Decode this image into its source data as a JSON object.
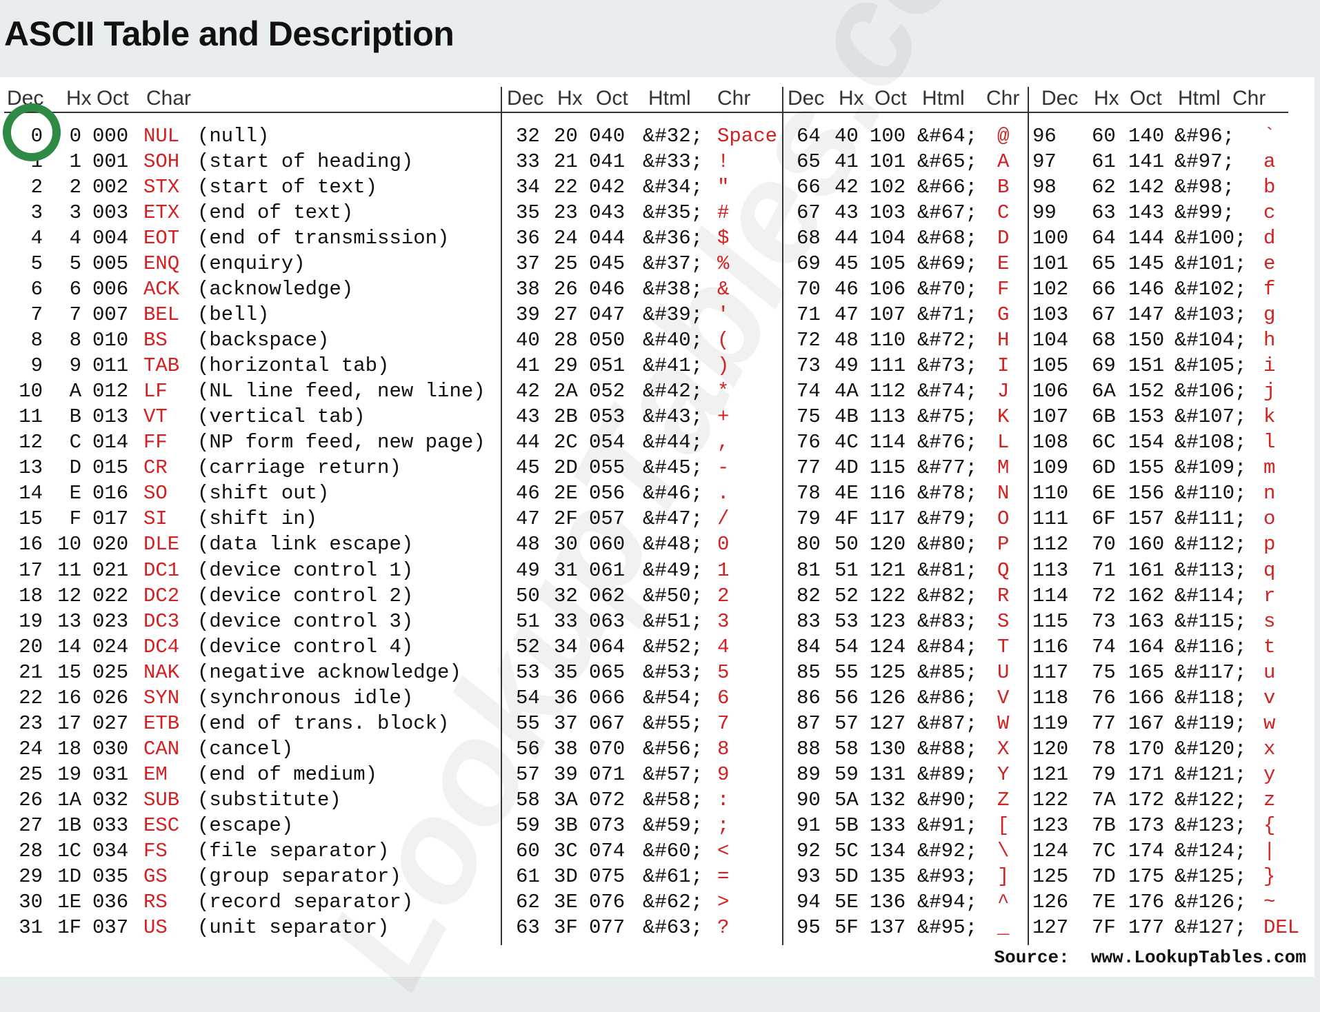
{
  "title": "ASCII Table and Description",
  "watermark": "LookupTables.com",
  "source": "Source:  www.LookupTables.com",
  "headers": {
    "g1": [
      "Dec",
      "Hx",
      "Oct",
      "Char"
    ],
    "g2": [
      "Dec",
      "Hx",
      "Oct",
      "Html",
      "Chr"
    ],
    "g3": [
      "Dec",
      "Hx",
      "Oct",
      "Html",
      "Chr"
    ],
    "g4": [
      "Dec",
      "Hx",
      "Oct",
      "Html",
      "Chr"
    ]
  },
  "control_chars": [
    [
      "0",
      "0",
      "000",
      "NUL",
      "(null)"
    ],
    [
      "1",
      "1",
      "001",
      "SOH",
      "(start of heading)"
    ],
    [
      "2",
      "2",
      "002",
      "STX",
      "(start of text)"
    ],
    [
      "3",
      "3",
      "003",
      "ETX",
      "(end of text)"
    ],
    [
      "4",
      "4",
      "004",
      "EOT",
      "(end of transmission)"
    ],
    [
      "5",
      "5",
      "005",
      "ENQ",
      "(enquiry)"
    ],
    [
      "6",
      "6",
      "006",
      "ACK",
      "(acknowledge)"
    ],
    [
      "7",
      "7",
      "007",
      "BEL",
      "(bell)"
    ],
    [
      "8",
      "8",
      "010",
      "BS",
      "(backspace)"
    ],
    [
      "9",
      "9",
      "011",
      "TAB",
      "(horizontal tab)"
    ],
    [
      "10",
      "A",
      "012",
      "LF",
      "(NL line feed, new line)"
    ],
    [
      "11",
      "B",
      "013",
      "VT",
      "(vertical tab)"
    ],
    [
      "12",
      "C",
      "014",
      "FF",
      "(NP form feed, new page)"
    ],
    [
      "13",
      "D",
      "015",
      "CR",
      "(carriage return)"
    ],
    [
      "14",
      "E",
      "016",
      "SO",
      "(shift out)"
    ],
    [
      "15",
      "F",
      "017",
      "SI",
      "(shift in)"
    ],
    [
      "16",
      "10",
      "020",
      "DLE",
      "(data link escape)"
    ],
    [
      "17",
      "11",
      "021",
      "DC1",
      "(device control 1)"
    ],
    [
      "18",
      "12",
      "022",
      "DC2",
      "(device control 2)"
    ],
    [
      "19",
      "13",
      "023",
      "DC3",
      "(device control 3)"
    ],
    [
      "20",
      "14",
      "024",
      "DC4",
      "(device control 4)"
    ],
    [
      "21",
      "15",
      "025",
      "NAK",
      "(negative acknowledge)"
    ],
    [
      "22",
      "16",
      "026",
      "SYN",
      "(synchronous idle)"
    ],
    [
      "23",
      "17",
      "027",
      "ETB",
      "(end of trans. block)"
    ],
    [
      "24",
      "18",
      "030",
      "CAN",
      "(cancel)"
    ],
    [
      "25",
      "19",
      "031",
      "EM",
      "(end of medium)"
    ],
    [
      "26",
      "1A",
      "032",
      "SUB",
      "(substitute)"
    ],
    [
      "27",
      "1B",
      "033",
      "ESC",
      "(escape)"
    ],
    [
      "28",
      "1C",
      "034",
      "FS",
      "(file separator)"
    ],
    [
      "29",
      "1D",
      "035",
      "GS",
      "(group separator)"
    ],
    [
      "30",
      "1E",
      "036",
      "RS",
      "(record separator)"
    ],
    [
      "31",
      "1F",
      "037",
      "US",
      "(unit separator)"
    ]
  ],
  "group2": [
    [
      "32",
      "20",
      "040",
      "&#32;",
      "Space"
    ],
    [
      "33",
      "21",
      "041",
      "&#33;",
      "!"
    ],
    [
      "34",
      "22",
      "042",
      "&#34;",
      "\""
    ],
    [
      "35",
      "23",
      "043",
      "&#35;",
      "#"
    ],
    [
      "36",
      "24",
      "044",
      "&#36;",
      "$"
    ],
    [
      "37",
      "25",
      "045",
      "&#37;",
      "%"
    ],
    [
      "38",
      "26",
      "046",
      "&#38;",
      "&"
    ],
    [
      "39",
      "27",
      "047",
      "&#39;",
      "'"
    ],
    [
      "40",
      "28",
      "050",
      "&#40;",
      "("
    ],
    [
      "41",
      "29",
      "051",
      "&#41;",
      ")"
    ],
    [
      "42",
      "2A",
      "052",
      "&#42;",
      "*"
    ],
    [
      "43",
      "2B",
      "053",
      "&#43;",
      "+"
    ],
    [
      "44",
      "2C",
      "054",
      "&#44;",
      ","
    ],
    [
      "45",
      "2D",
      "055",
      "&#45;",
      "-"
    ],
    [
      "46",
      "2E",
      "056",
      "&#46;",
      "."
    ],
    [
      "47",
      "2F",
      "057",
      "&#47;",
      "/"
    ],
    [
      "48",
      "30",
      "060",
      "&#48;",
      "0"
    ],
    [
      "49",
      "31",
      "061",
      "&#49;",
      "1"
    ],
    [
      "50",
      "32",
      "062",
      "&#50;",
      "2"
    ],
    [
      "51",
      "33",
      "063",
      "&#51;",
      "3"
    ],
    [
      "52",
      "34",
      "064",
      "&#52;",
      "4"
    ],
    [
      "53",
      "35",
      "065",
      "&#53;",
      "5"
    ],
    [
      "54",
      "36",
      "066",
      "&#54;",
      "6"
    ],
    [
      "55",
      "37",
      "067",
      "&#55;",
      "7"
    ],
    [
      "56",
      "38",
      "070",
      "&#56;",
      "8"
    ],
    [
      "57",
      "39",
      "071",
      "&#57;",
      "9"
    ],
    [
      "58",
      "3A",
      "072",
      "&#58;",
      ":"
    ],
    [
      "59",
      "3B",
      "073",
      "&#59;",
      ";"
    ],
    [
      "60",
      "3C",
      "074",
      "&#60;",
      "<"
    ],
    [
      "61",
      "3D",
      "075",
      "&#61;",
      "="
    ],
    [
      "62",
      "3E",
      "076",
      "&#62;",
      ">"
    ],
    [
      "63",
      "3F",
      "077",
      "&#63;",
      "?"
    ]
  ],
  "group3": [
    [
      "64",
      "40",
      "100",
      "&#64;",
      "@"
    ],
    [
      "65",
      "41",
      "101",
      "&#65;",
      "A"
    ],
    [
      "66",
      "42",
      "102",
      "&#66;",
      "B"
    ],
    [
      "67",
      "43",
      "103",
      "&#67;",
      "C"
    ],
    [
      "68",
      "44",
      "104",
      "&#68;",
      "D"
    ],
    [
      "69",
      "45",
      "105",
      "&#69;",
      "E"
    ],
    [
      "70",
      "46",
      "106",
      "&#70;",
      "F"
    ],
    [
      "71",
      "47",
      "107",
      "&#71;",
      "G"
    ],
    [
      "72",
      "48",
      "110",
      "&#72;",
      "H"
    ],
    [
      "73",
      "49",
      "111",
      "&#73;",
      "I"
    ],
    [
      "74",
      "4A",
      "112",
      "&#74;",
      "J"
    ],
    [
      "75",
      "4B",
      "113",
      "&#75;",
      "K"
    ],
    [
      "76",
      "4C",
      "114",
      "&#76;",
      "L"
    ],
    [
      "77",
      "4D",
      "115",
      "&#77;",
      "M"
    ],
    [
      "78",
      "4E",
      "116",
      "&#78;",
      "N"
    ],
    [
      "79",
      "4F",
      "117",
      "&#79;",
      "O"
    ],
    [
      "80",
      "50",
      "120",
      "&#80;",
      "P"
    ],
    [
      "81",
      "51",
      "121",
      "&#81;",
      "Q"
    ],
    [
      "82",
      "52",
      "122",
      "&#82;",
      "R"
    ],
    [
      "83",
      "53",
      "123",
      "&#83;",
      "S"
    ],
    [
      "84",
      "54",
      "124",
      "&#84;",
      "T"
    ],
    [
      "85",
      "55",
      "125",
      "&#85;",
      "U"
    ],
    [
      "86",
      "56",
      "126",
      "&#86;",
      "V"
    ],
    [
      "87",
      "57",
      "127",
      "&#87;",
      "W"
    ],
    [
      "88",
      "58",
      "130",
      "&#88;",
      "X"
    ],
    [
      "89",
      "59",
      "131",
      "&#89;",
      "Y"
    ],
    [
      "90",
      "5A",
      "132",
      "&#90;",
      "Z"
    ],
    [
      "91",
      "5B",
      "133",
      "&#91;",
      "["
    ],
    [
      "92",
      "5C",
      "134",
      "&#92;",
      "\\"
    ],
    [
      "93",
      "5D",
      "135",
      "&#93;",
      "]"
    ],
    [
      "94",
      "5E",
      "136",
      "&#94;",
      "^"
    ],
    [
      "95",
      "5F",
      "137",
      "&#95;",
      "_"
    ]
  ],
  "group4": [
    [
      "96",
      "60",
      "140",
      "&#96;",
      "`"
    ],
    [
      "97",
      "61",
      "141",
      "&#97;",
      "a"
    ],
    [
      "98",
      "62",
      "142",
      "&#98;",
      "b"
    ],
    [
      "99",
      "63",
      "143",
      "&#99;",
      "c"
    ],
    [
      "100",
      "64",
      "144",
      "&#100;",
      "d"
    ],
    [
      "101",
      "65",
      "145",
      "&#101;",
      "e"
    ],
    [
      "102",
      "66",
      "146",
      "&#102;",
      "f"
    ],
    [
      "103",
      "67",
      "147",
      "&#103;",
      "g"
    ],
    [
      "104",
      "68",
      "150",
      "&#104;",
      "h"
    ],
    [
      "105",
      "69",
      "151",
      "&#105;",
      "i"
    ],
    [
      "106",
      "6A",
      "152",
      "&#106;",
      "j"
    ],
    [
      "107",
      "6B",
      "153",
      "&#107;",
      "k"
    ],
    [
      "108",
      "6C",
      "154",
      "&#108;",
      "l"
    ],
    [
      "109",
      "6D",
      "155",
      "&#109;",
      "m"
    ],
    [
      "110",
      "6E",
      "156",
      "&#110;",
      "n"
    ],
    [
      "111",
      "6F",
      "157",
      "&#111;",
      "o"
    ],
    [
      "112",
      "70",
      "160",
      "&#112;",
      "p"
    ],
    [
      "113",
      "71",
      "161",
      "&#113;",
      "q"
    ],
    [
      "114",
      "72",
      "162",
      "&#114;",
      "r"
    ],
    [
      "115",
      "73",
      "163",
      "&#115;",
      "s"
    ],
    [
      "116",
      "74",
      "164",
      "&#116;",
      "t"
    ],
    [
      "117",
      "75",
      "165",
      "&#117;",
      "u"
    ],
    [
      "118",
      "76",
      "166",
      "&#118;",
      "v"
    ],
    [
      "119",
      "77",
      "167",
      "&#119;",
      "w"
    ],
    [
      "120",
      "78",
      "170",
      "&#120;",
      "x"
    ],
    [
      "121",
      "79",
      "171",
      "&#121;",
      "y"
    ],
    [
      "122",
      "7A",
      "172",
      "&#122;",
      "z"
    ],
    [
      "123",
      "7B",
      "173",
      "&#123;",
      "{"
    ],
    [
      "124",
      "7C",
      "174",
      "&#124;",
      "|"
    ],
    [
      "125",
      "7D",
      "175",
      "&#125;",
      "}"
    ],
    [
      "126",
      "7E",
      "176",
      "&#126;",
      "~"
    ],
    [
      "127",
      "7F",
      "177",
      "&#127;",
      "DEL"
    ]
  ],
  "colors": {
    "char_red": "#d42020",
    "highlight_circle": "#2e8a44",
    "text": "#111111"
  }
}
